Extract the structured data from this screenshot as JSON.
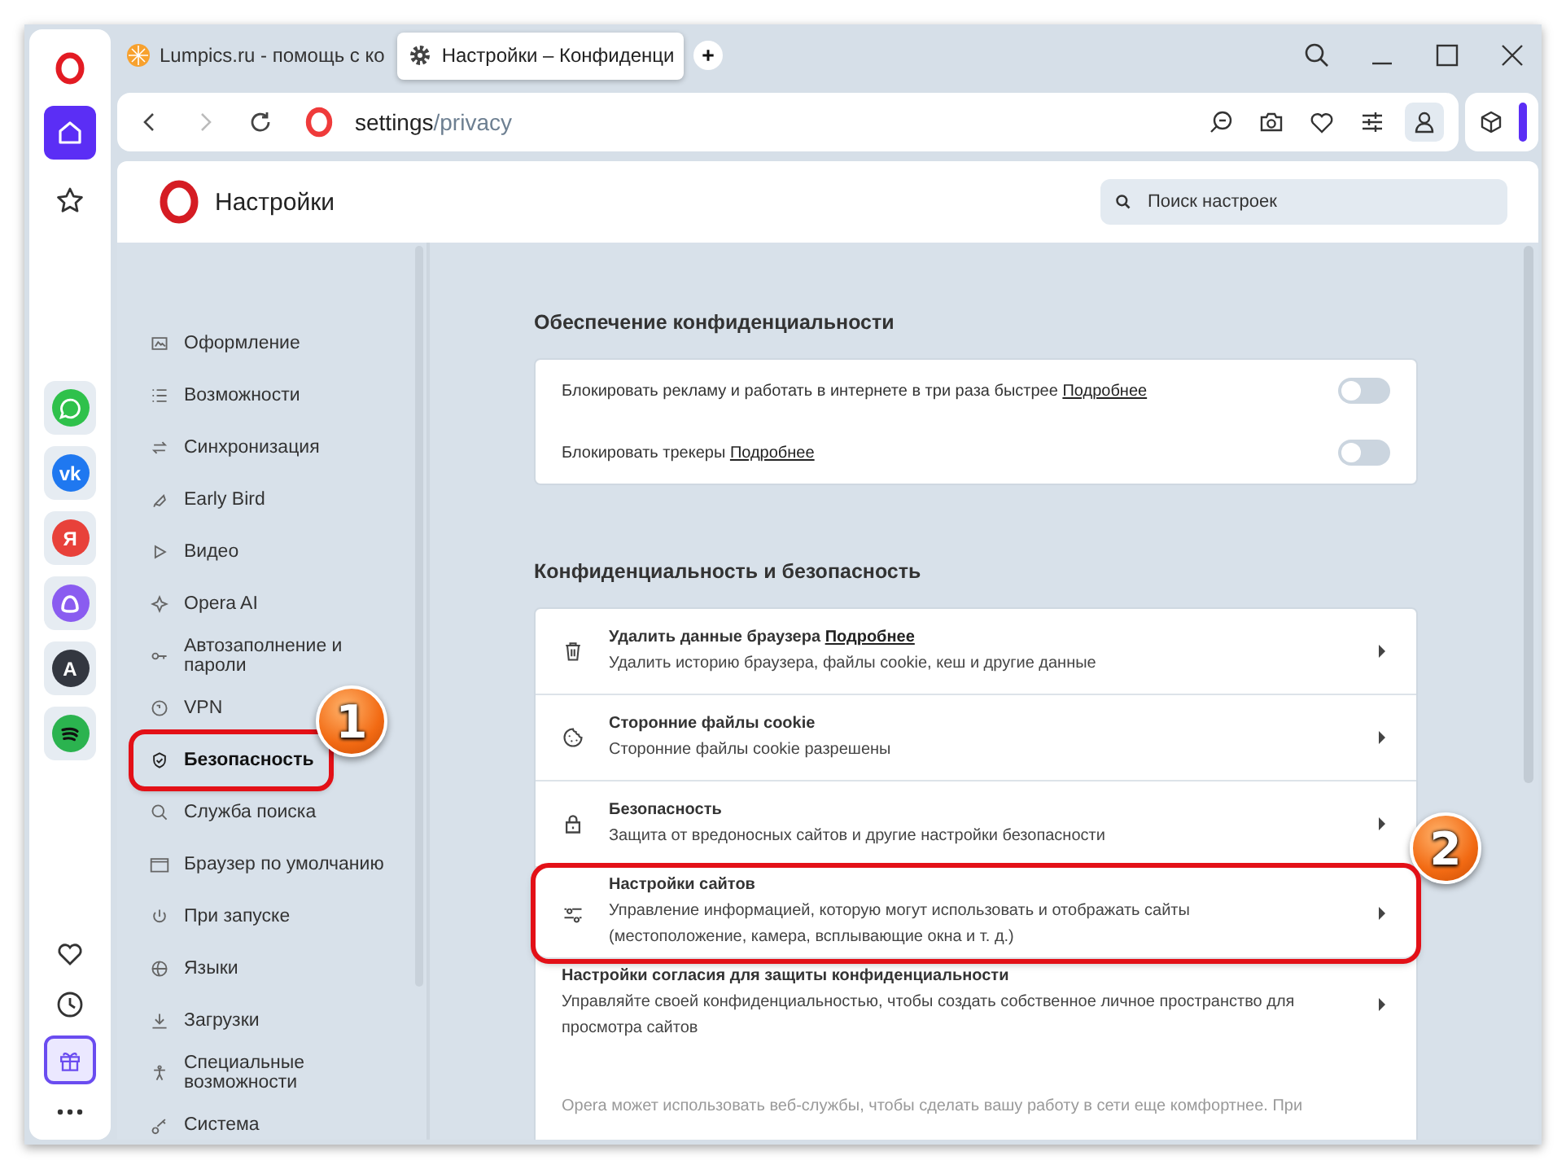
{
  "tabs": [
    {
      "label": "Lumpics.ru - помощь с ко",
      "selected": false,
      "kind": "site"
    },
    {
      "label": "Настройки – Конфиденци",
      "selected": true,
      "kind": "settings"
    }
  ],
  "address": {
    "host": "settings",
    "path": "/privacy"
  },
  "rail_apps": [
    {
      "kind": "chat"
    },
    {
      "kind": "vk",
      "glyph": "vk"
    },
    {
      "kind": "letter",
      "glyph": "Я"
    },
    {
      "kind": "assistant"
    },
    {
      "kind": "translate",
      "glyph": "A"
    },
    {
      "kind": "music"
    }
  ],
  "header": {
    "title": "Настройки",
    "search_placeholder": "Поиск настроек"
  },
  "nav": [
    {
      "label": "Оформление",
      "selected": false
    },
    {
      "label": "Возможности",
      "selected": false
    },
    {
      "label": "Синхронизация",
      "selected": false
    },
    {
      "label": "Early Bird",
      "selected": false
    },
    {
      "label": "Видео",
      "selected": false
    },
    {
      "label": "Opera AI",
      "selected": false
    },
    {
      "label": "Автозаполнение и пароли",
      "selected": false
    },
    {
      "label": "VPN",
      "selected": false
    },
    {
      "label": "Безопасность",
      "selected": true,
      "callout": "1"
    },
    {
      "label": "Служба поиска",
      "selected": false
    },
    {
      "label": "Браузер по умолчанию",
      "selected": false
    },
    {
      "label": "При запуске",
      "selected": false
    },
    {
      "label": "Языки",
      "selected": false
    },
    {
      "label": "Загрузки",
      "selected": false
    },
    {
      "label": "Специальные возможности",
      "selected": false
    },
    {
      "label": "Система",
      "selected": false
    }
  ],
  "sections": [
    {
      "title": "Обеспечение конфиденциальности",
      "rows": [
        {
          "kind": "toggle",
          "text": "Блокировать рекламу и работать в интернете в три раза быстрее",
          "link": "Подробнее",
          "on": false
        },
        {
          "kind": "toggle",
          "text": "Блокировать трекеры",
          "link": "Подробнее",
          "on": false
        }
      ]
    },
    {
      "title": "Конфиденциальность и безопасность",
      "rows": [
        {
          "kind": "entry",
          "title": "Удалить данные браузера",
          "link": "Подробнее",
          "subtitle": "Удалить историю браузера, файлы cookie, кеш и другие данные",
          "highlighted": false
        },
        {
          "kind": "entry",
          "title": "Сторонние файлы cookie",
          "subtitle": "Сторонние файлы cookie разрешены",
          "highlighted": false
        },
        {
          "kind": "entry",
          "title": "Безопасность",
          "subtitle": "Защита от вредоносных сайтов и другие настройки безопасности",
          "highlighted": false
        },
        {
          "kind": "entry",
          "title": "Настройки сайтов",
          "subtitle": "Управление информацией, которую могут использовать и отображать сайты (местоположение, камера, всплывающие окна и т. д.)",
          "highlighted": true,
          "callout": "2"
        },
        {
          "kind": "plain",
          "title": "Настройки согласия для защиты конфиденциальности",
          "subtitle": "Управляйте своей конфиденциальностью, чтобы создать собственное личное пространство для просмотра сайтов",
          "highlighted": false
        }
      ]
    }
  ],
  "footer_note": "Opera может использовать веб-службы, чтобы сделать вашу работу в сети еще комфортнее. При"
}
